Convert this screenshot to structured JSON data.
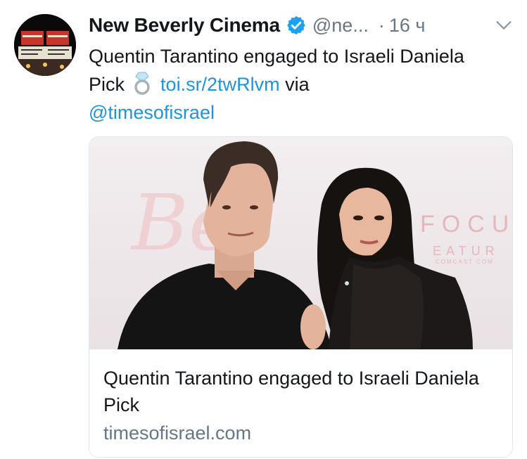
{
  "tweet": {
    "author_name": "New Beverly Cinema",
    "handle": "@ne...",
    "separator": "·",
    "time": "16 ч",
    "verified": true,
    "text_part1": "Quentin Tarantino engaged to Israeli Daniela Pick",
    "emoji": "ring-emoji",
    "link_text": "toi.sr/2twRlvm",
    "via_text": "via",
    "mention": "@timesofisrael"
  },
  "card": {
    "title": "Quentin Tarantino engaged to Israeli Daniela Pick",
    "domain": "timesofisrael.com",
    "image_backdrop_text": "FOCU",
    "image_backdrop_text2": "EATUR",
    "image_backdrop_text3": "COMCAST COM"
  },
  "colors": {
    "link": "#1b95e0",
    "secondary_text": "#657786",
    "verified_badge": "#1da1f2",
    "card_border": "#e1e8ed"
  }
}
